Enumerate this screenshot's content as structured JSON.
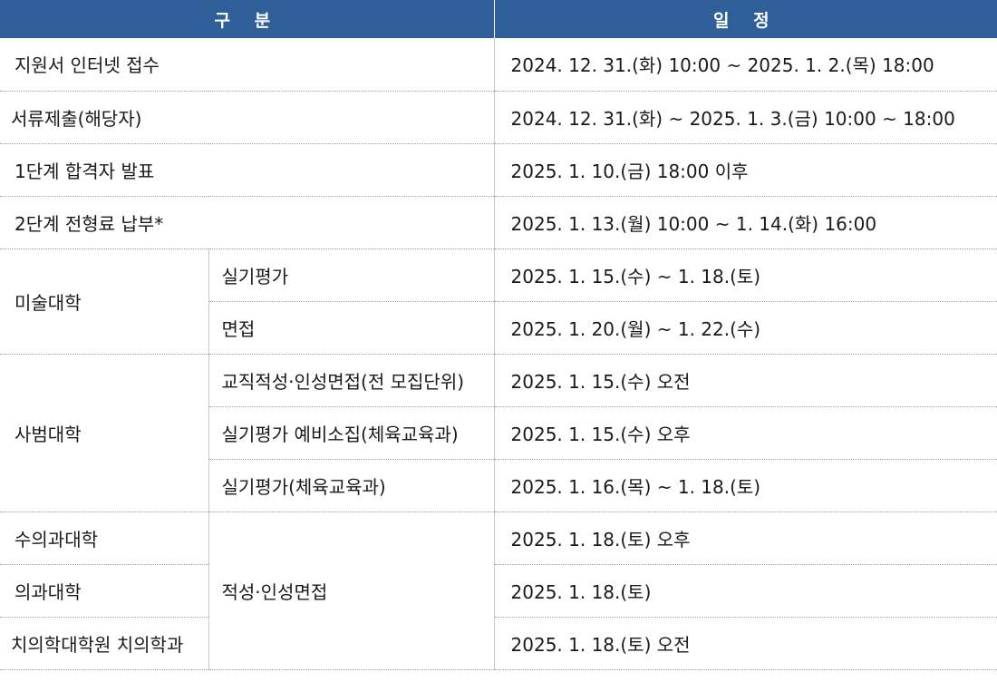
{
  "header": {
    "category": "구 분",
    "schedule": "일 정"
  },
  "rows": {
    "r1": {
      "label": "지원서 인터넷 접수",
      "date": "2024. 12. 31.(화) 10:00 ~ 2025. 1. 2.(목) 18:00"
    },
    "r2": {
      "label": "서류제출(해당자)",
      "date": "2024. 12. 31.(화) ~ 2025. 1. 3.(금) 10:00 ~ 18:00"
    },
    "r3": {
      "label": "1단계 합격자 발표",
      "date": "2025. 1. 10.(금) 18:00 이후"
    },
    "r4": {
      "label": "2단계 전형료 납부*",
      "date": "2025. 1. 13.(월) 10:00 ~ 1. 14.(화) 16:00"
    },
    "art": {
      "label": "미술대학",
      "items": [
        {
          "sub": "실기평가",
          "date": "2025. 1. 15.(수) ~ 1. 18.(토)"
        },
        {
          "sub": "면접",
          "date": "2025. 1. 20.(월) ~ 1. 22.(수)"
        }
      ]
    },
    "edu": {
      "label": "사범대학",
      "items": [
        {
          "sub": "교직적성·인성면접(전 모집단위)",
          "date": "2025. 1. 15.(수) 오전"
        },
        {
          "sub": "실기평가 예비소집(체육교육과)",
          "date": "2025. 1. 15.(수) 오후"
        },
        {
          "sub": "실기평가(체육교육과)",
          "date": "2025. 1. 16.(목) ~ 1. 18.(토)"
        }
      ]
    },
    "med": {
      "sub": "적성·인성면접",
      "items": [
        {
          "label": "수의과대학",
          "date": "2025. 1. 18.(토) 오후"
        },
        {
          "label": "의과대학",
          "date": "2025. 1. 18.(토)"
        },
        {
          "label": "치의학대학원 치의학과",
          "date": "2025. 1. 18.(토) 오전"
        }
      ]
    }
  }
}
